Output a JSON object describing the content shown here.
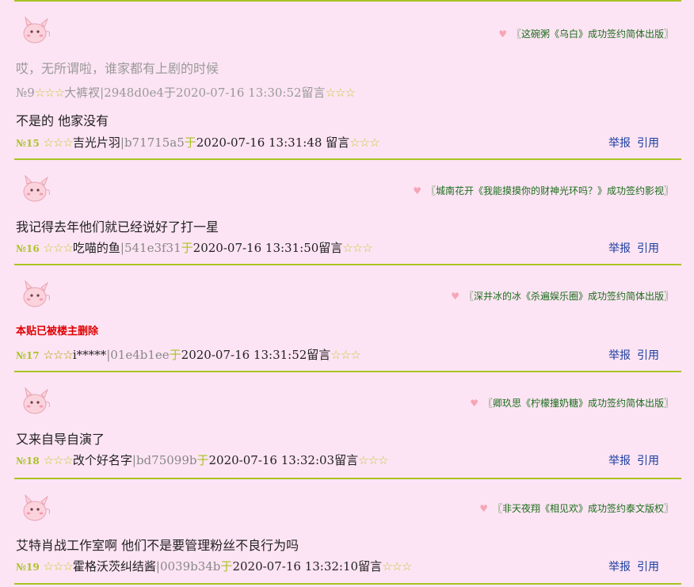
{
  "posts": [
    {
      "signature": "〖这碗粥《乌白》成功签约简体出版〗",
      "quote_text": "哎，无所谓啦，谁家都有上剧的时候",
      "quote_meta": {
        "no": "№9",
        "stars_before": "☆☆☆",
        "name": "大裤衩",
        "id": "|2948d0e4",
        "yu": "于",
        "time": "2020-07-16 13:30:52",
        "suffix": "留言",
        "stars_after": "☆☆☆"
      },
      "text": "不是的 他家没有",
      "meta": {
        "no": "№15",
        "stars_before": "☆☆☆",
        "name": "吉光片羽",
        "id": "|b71715a5",
        "yu": "于",
        "time": "2020-07-16 13:31:48",
        "suffix": "留言",
        "stars_after": "☆☆☆"
      },
      "report": "举报",
      "reply": "引用"
    },
    {
      "signature": "〖城南花开《我能摸摸你的财神光环吗？》成功签约影视〗",
      "text": "我记得去年他们就已经说好了打一星",
      "meta": {
        "no": "№16",
        "stars_before": "☆☆☆",
        "name": "吃喵的鱼",
        "id": "|541e3f31",
        "yu": "于",
        "time": "2020-07-16 13:31:50",
        "suffix": "留言",
        "stars_after": "☆☆☆"
      },
      "report": "举报",
      "reply": "引用"
    },
    {
      "signature": "〖深井冰的冰《杀遍娱乐圈》成功签约简体出版〗",
      "text": "本贴已被楼主删除",
      "meta": {
        "no": "№17",
        "stars_before": "☆☆☆",
        "name": "i*****",
        "id": "|01e4b1ee",
        "yu": "于",
        "time": "2020-07-16 13:31:52",
        "suffix": "留言",
        "stars_after": "☆☆☆"
      },
      "report": "举报",
      "reply": "引用"
    },
    {
      "signature": "〖卿玖思《柠檬撞奶糖》成功签约简体出版〗",
      "text": "又来自导自演了",
      "meta": {
        "no": "№18",
        "stars_before": "☆☆☆",
        "name": "改个好名字",
        "id": "|bd75099b",
        "yu": "于",
        "time": "2020-07-16 13:32:03",
        "suffix": "留言",
        "stars_after": "☆☆☆"
      },
      "report": "举报",
      "reply": "引用"
    },
    {
      "signature": "〖非天夜翔《相见欢》成功签约泰文版权〗",
      "text": "艾特肖战工作室啊 他们不是要管理粉丝不良行为吗",
      "meta": {
        "no": "№19",
        "stars_before": "☆☆☆",
        "name": "霍格沃茨纠结酱",
        "id": "|0039b34b",
        "yu": "于",
        "time": "2020-07-16 13:32:10",
        "suffix": "留言",
        "stars_after": "☆☆☆"
      },
      "report": "举报",
      "reply": "引用"
    }
  ],
  "colors": {
    "background": "#fde4f4",
    "divider": "#a8c423",
    "signature": "#1a6e1a",
    "link": "#1b3fa0",
    "deleted": "#e00000"
  },
  "icons": {
    "avatar": "clefairy-avatar-icon",
    "heart": "heart-icon"
  }
}
